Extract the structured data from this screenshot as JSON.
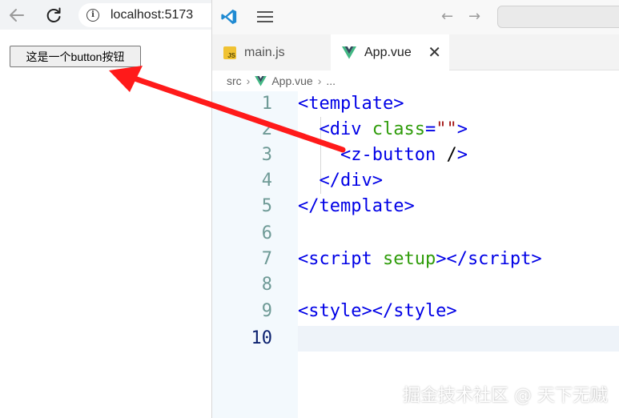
{
  "browser": {
    "url": "localhost:5173",
    "page_button_label": "这是一个button按钮"
  },
  "editor": {
    "tabs": [
      {
        "label": "main.js",
        "icon": "js-file-icon",
        "active": false
      },
      {
        "label": "App.vue",
        "icon": "vue-file-icon",
        "active": true
      }
    ],
    "breadcrumb": {
      "folder": "src",
      "file": "App.vue",
      "more": "..."
    },
    "line_numbers": [
      "1",
      "2",
      "3",
      "4",
      "5",
      "6",
      "7",
      "8",
      "9",
      "10"
    ],
    "current_line": "10"
  },
  "annotation": {
    "arrow_color": "#ff1a1a"
  },
  "watermark": "掘金技术社区 @ 天下无贼"
}
